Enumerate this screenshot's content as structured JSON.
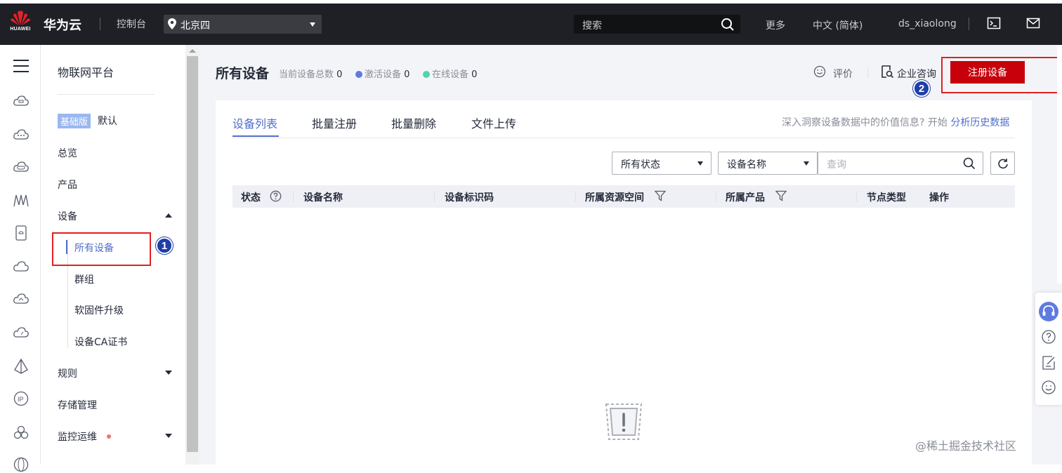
{
  "topbar": {
    "logo_text": "HUAWEI",
    "brand": "华为云",
    "console": "控制台",
    "region": "北京四",
    "search_placeholder": "搜索",
    "more": "更多",
    "language": "中文 (简体)",
    "username": "ds_xiaolong"
  },
  "sidebar": {
    "title": "物联网平台",
    "edition_badge": "基础版",
    "edition_name": "默认",
    "items": [
      {
        "label": "总览"
      },
      {
        "label": "产品"
      },
      {
        "label": "设备"
      },
      {
        "label": "规则"
      },
      {
        "label": "存储管理"
      },
      {
        "label": "监控运维"
      }
    ],
    "device_sub": [
      {
        "label": "所有设备"
      },
      {
        "label": "群组"
      },
      {
        "label": "软固件升级"
      },
      {
        "label": "设备CA证书"
      }
    ]
  },
  "annotations": {
    "step1": "1",
    "step2": "2"
  },
  "header": {
    "title": "所有设备",
    "total_label": "当前设备总数",
    "total_value": "0",
    "active_label": "激活设备",
    "active_value": "0",
    "online_label": "在线设备",
    "online_value": "0",
    "rate_label": "评价",
    "consult_label": "企业咨询",
    "register_button": "注册设备"
  },
  "tabs": [
    {
      "label": "设备列表"
    },
    {
      "label": "批量注册"
    },
    {
      "label": "批量删除"
    },
    {
      "label": "文件上传"
    }
  ],
  "insight": {
    "text": "深入洞察设备数据中的价值信息? 开始",
    "link": "分析历史数据"
  },
  "filters": {
    "status_select": "所有状态",
    "field_select": "设备名称",
    "query_placeholder": "查询"
  },
  "table": {
    "columns": [
      "状态",
      "设备名称",
      "设备标识码",
      "所属资源空间",
      "所属产品",
      "节点类型",
      "操作"
    ],
    "rows": []
  },
  "watermark": "@稀土掘金技术社区",
  "colors": {
    "topbar_bg": "#1e2025",
    "accent_blue": "#526ecc",
    "brand_red": "#c7000b",
    "annotation_red": "#e02020",
    "active_dot": "#5e7ce0",
    "online_dot": "#50d4ab"
  }
}
